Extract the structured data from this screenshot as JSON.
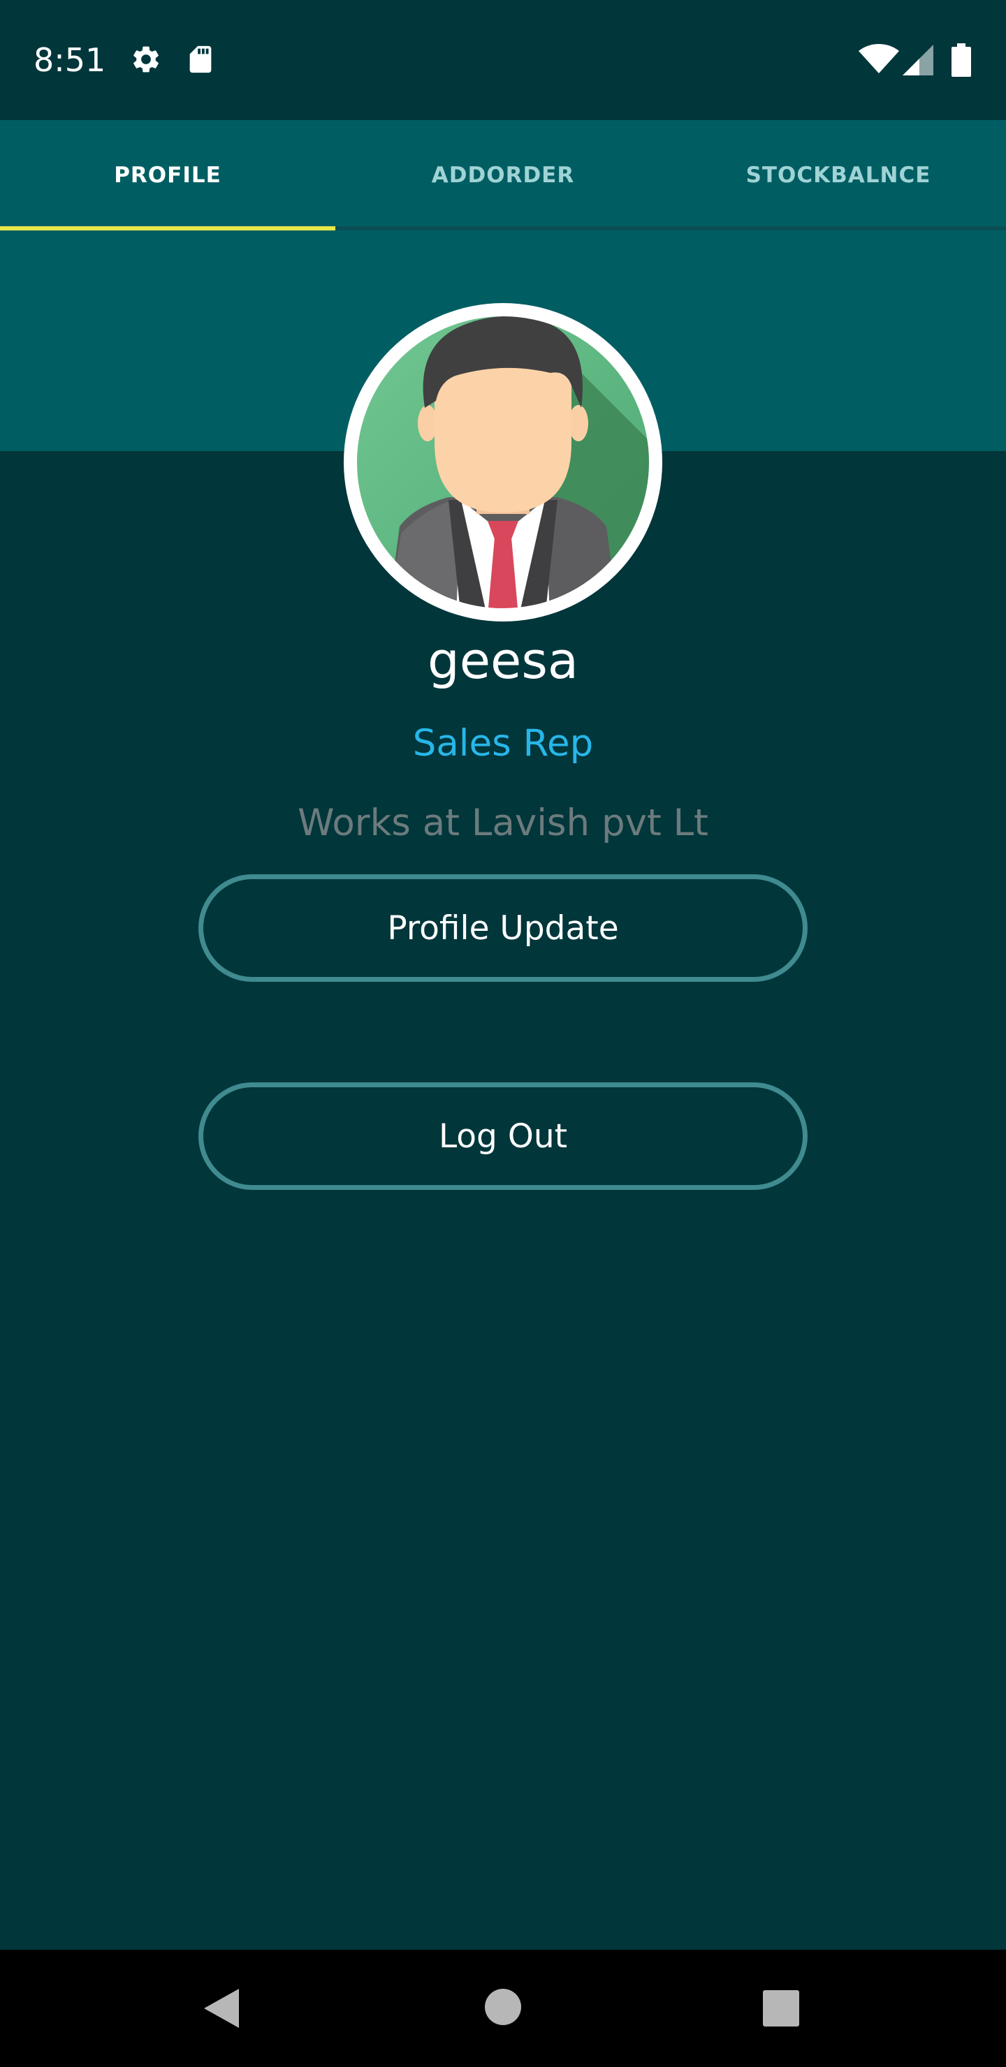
{
  "status_bar": {
    "time": "8:51",
    "icons": [
      "settings-icon",
      "sd-card-icon",
      "wifi-icon",
      "signal-icon",
      "battery-icon"
    ]
  },
  "tabs": [
    {
      "label": "PROFILE",
      "active": true
    },
    {
      "label": "ADDORDER",
      "active": false
    },
    {
      "label": "STOCKBALNCE",
      "active": false
    }
  ],
  "profile": {
    "name": "geesa",
    "role": "Sales Rep",
    "company": "Works at Lavish pvt Lt",
    "avatar_icon": "businessman-avatar-icon"
  },
  "buttons": {
    "profile_update": "Profile Update",
    "log_out": "Log Out"
  },
  "nav_bar": {
    "icons": [
      "back-icon",
      "home-icon",
      "recents-icon"
    ]
  },
  "colors": {
    "background": "#01363b",
    "tab_bar": "#005e63",
    "tab_indicator": "#e6e84a",
    "role_text": "#28b6e8",
    "company_text": "#6c7b7d",
    "button_border": "#3f8b8f"
  }
}
